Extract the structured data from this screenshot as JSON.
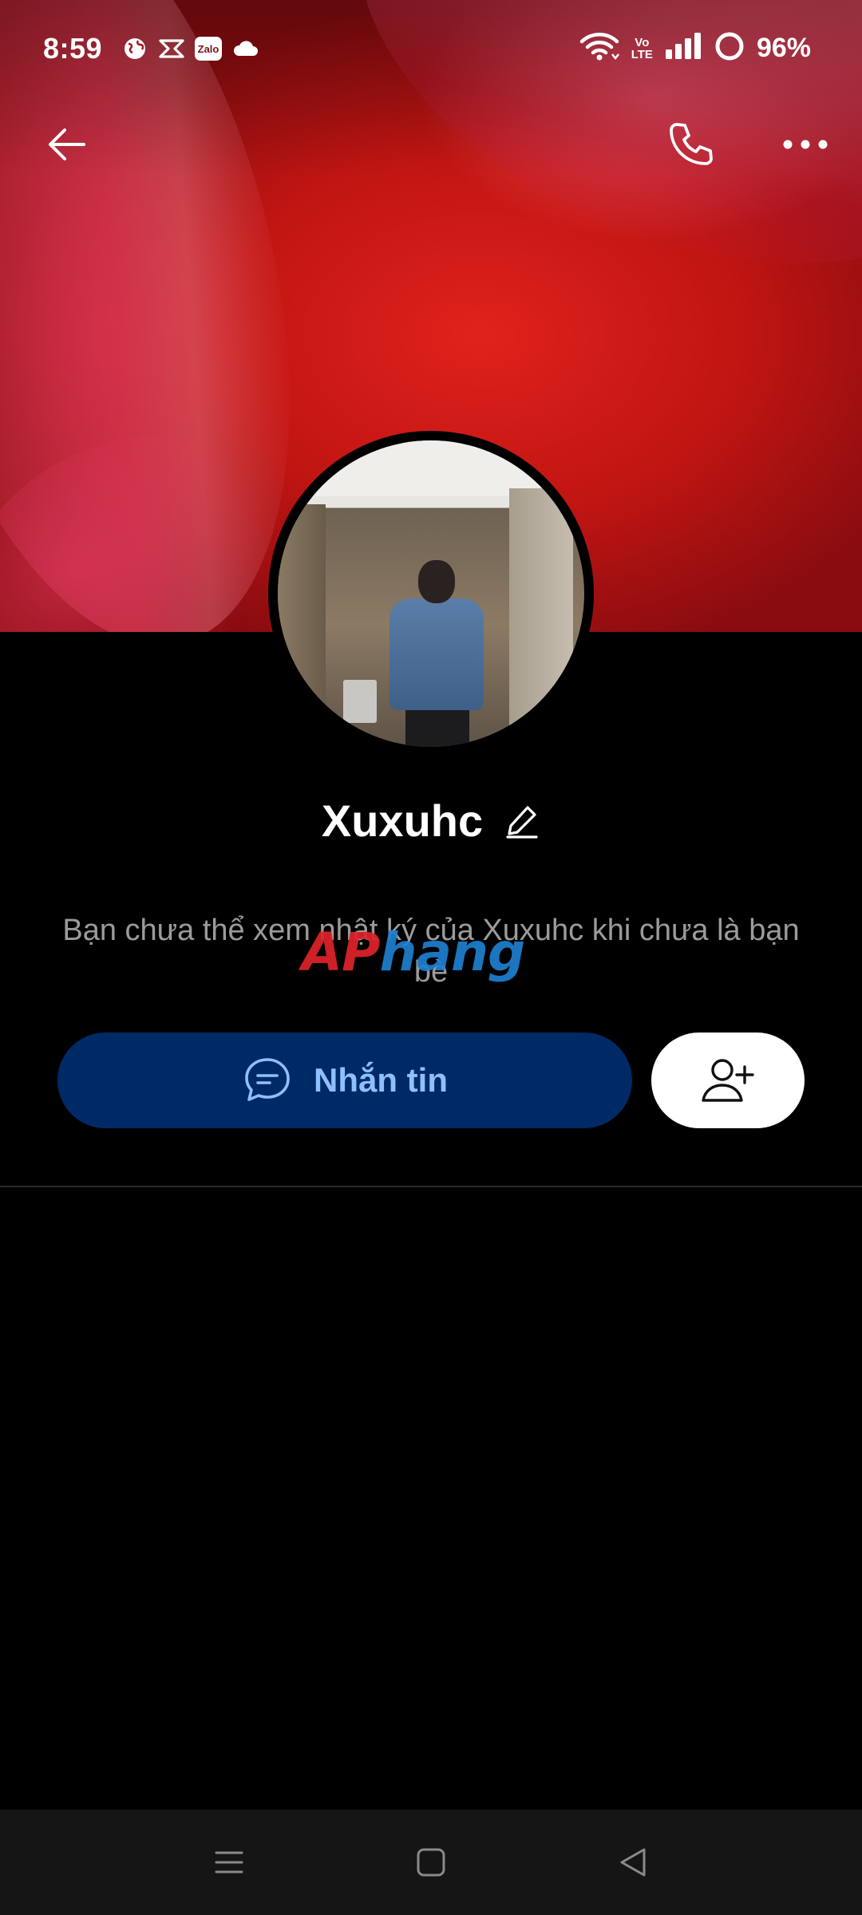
{
  "status_bar": {
    "time": "8:59",
    "notification_icons": [
      "globe-icon",
      "capcut-icon",
      "zalo-icon",
      "cloud-icon"
    ],
    "zalo_chip_text": "Zalo",
    "volte_top": "Vo",
    "volte_bottom": "LTE",
    "battery": "96%"
  },
  "profile": {
    "name": "Xuxuhc",
    "privacy_notice": "Bạn chưa thể xem nhật ký của Xuxuhc khi chưa là bạn bè",
    "watermark_red": "AP",
    "watermark_blue": "hang"
  },
  "actions": {
    "message_label": "Nhắn tin"
  },
  "colors": {
    "message_button_bg": "#002a66",
    "message_button_text": "#8ec0ff",
    "background": "#000000",
    "navbar_bg": "#151515"
  }
}
